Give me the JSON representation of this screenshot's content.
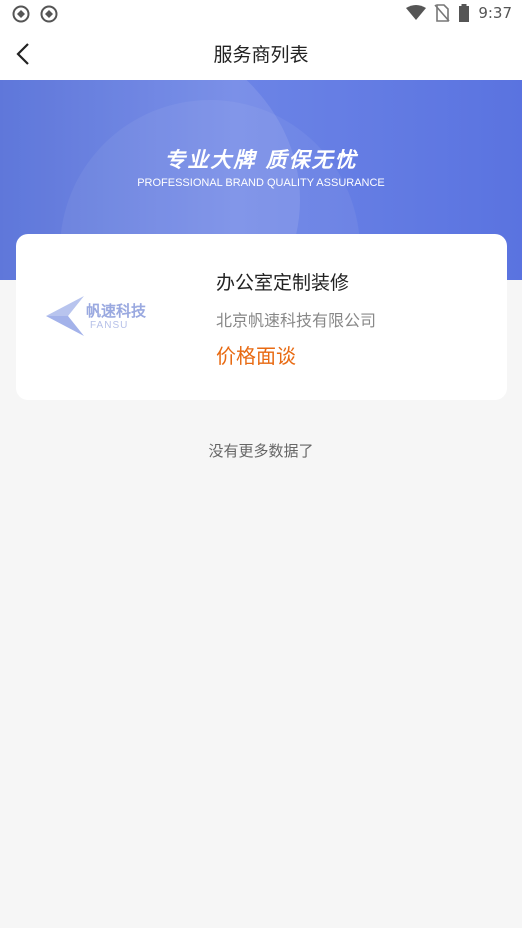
{
  "status_bar": {
    "time": "9:37"
  },
  "nav": {
    "title": "服务商列表"
  },
  "banner": {
    "title_cn": "专业大牌  质保无忧",
    "title_en": "PROFESSIONAL BRAND QUALITY ASSURANCE"
  },
  "card": {
    "logo_cn": "帆速科技",
    "logo_en": "FANSU",
    "service_name": "办公室定制装修",
    "company_name": "北京帆速科技有限公司",
    "price": "价格面谈"
  },
  "list": {
    "no_more": "没有更多数据了"
  },
  "colors": {
    "banner": "#5a73e0",
    "price": "#e86a12"
  }
}
